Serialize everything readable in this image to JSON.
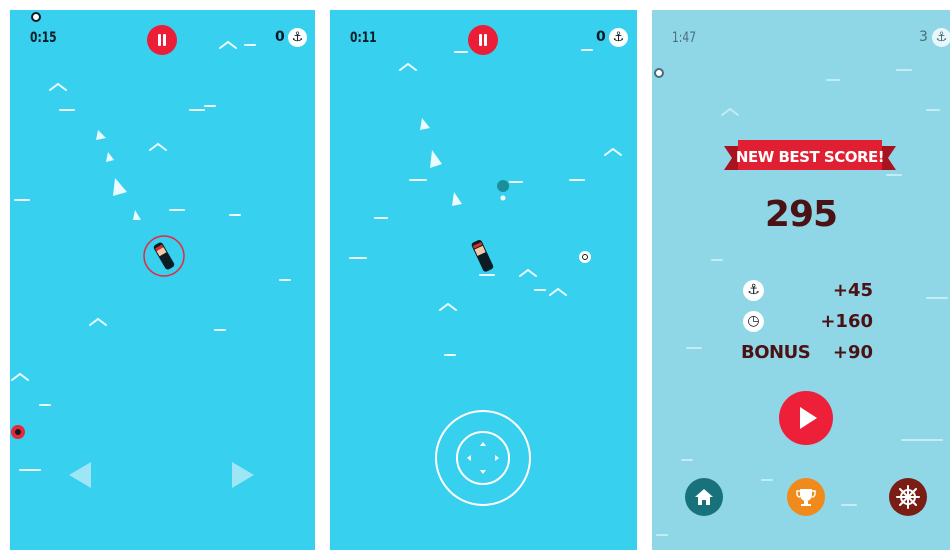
{
  "screen1": {
    "timer": "0:15",
    "score": "0",
    "anchor_icon": "anchor-icon",
    "pause_icon": "pause-icon",
    "controls": [
      "left-arrow",
      "right-arrow"
    ]
  },
  "screen2": {
    "timer": "0:11",
    "score": "0",
    "anchor_icon": "anchor-icon",
    "pause_icon": "pause-icon",
    "controls": [
      "joystick"
    ]
  },
  "screen3": {
    "timer": "1:47",
    "score": "3",
    "banner": "NEW BEST SCORE!",
    "best_score": "295",
    "stats": [
      {
        "icon": "anchor-icon",
        "value": "+45"
      },
      {
        "icon": "clock-icon",
        "value": "+160"
      },
      {
        "label": "BONUS",
        "value": "+90"
      }
    ],
    "buttons": [
      "play-button",
      "home-button",
      "trophy-button",
      "settings-button"
    ]
  },
  "colors": {
    "sea_active": "#37d0ef",
    "sea_gameover": "#8fd6e6",
    "accent_red": "#ec1d36",
    "score_text": "#4a1215",
    "home_button": "#17727c",
    "trophy_button": "#f08a1b",
    "settings_button": "#7a1e15"
  }
}
